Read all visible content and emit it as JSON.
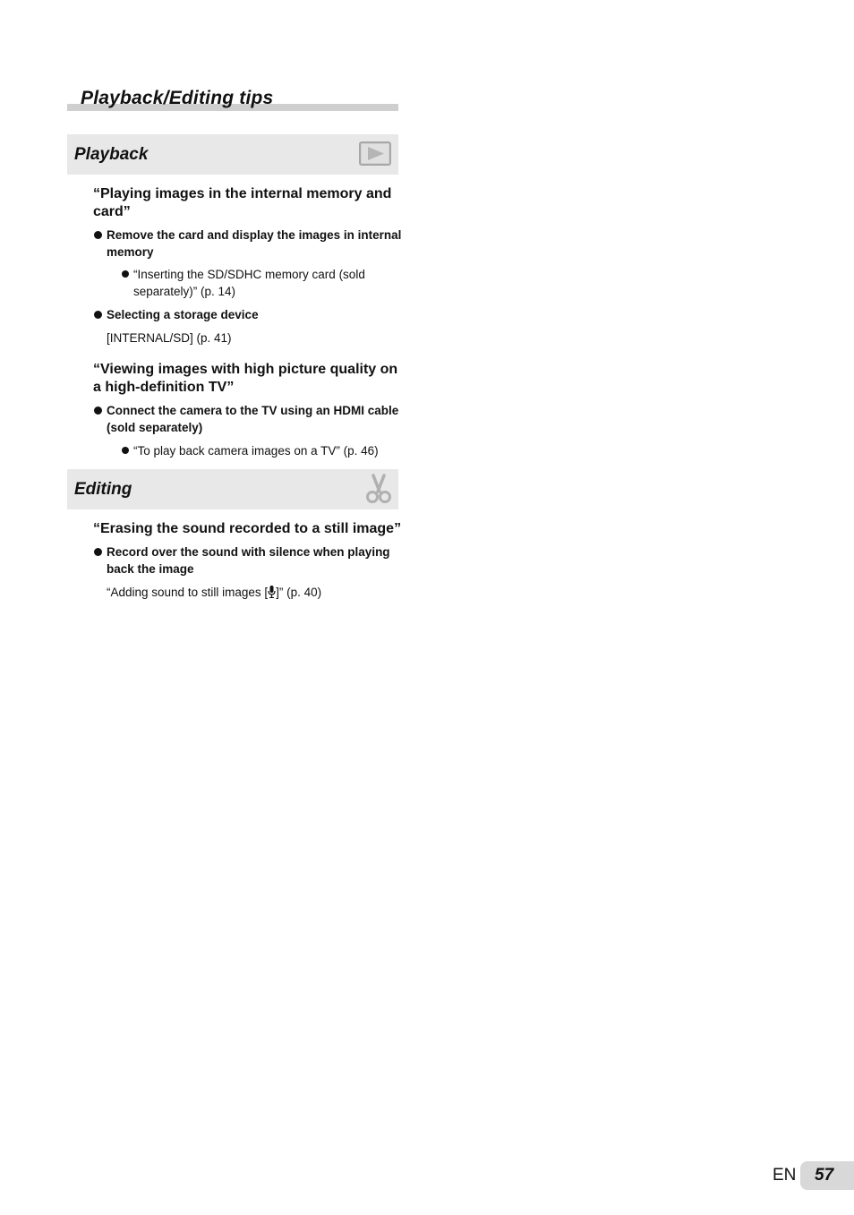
{
  "page_title": "Playback/Editing tips",
  "sections": [
    {
      "heading": "Playback",
      "icon": "playback-icon",
      "topics": [
        {
          "question": "“Playing images in the internal memory and card”",
          "items": [
            {
              "text": "Remove the card and display the images in internal memory",
              "sub": [
                "“Inserting the SD/SDHC memory card (sold separately)” (p. 14)"
              ]
            },
            {
              "text": "Selecting a storage device",
              "note": "[INTERNAL/SD] (p. 41)"
            }
          ]
        },
        {
          "question": "“Viewing images with high picture quality on a high-definition TV”",
          "items": [
            {
              "text": "Connect the camera to the TV using an HDMI cable (sold separately)",
              "sub": [
                "“To play back camera images on a TV” (p. 46)"
              ]
            }
          ]
        }
      ]
    },
    {
      "heading": "Editing",
      "icon": "scissors-icon",
      "topics": [
        {
          "question": "“Erasing the sound recorded to a still image”",
          "items": [
            {
              "text": "Record over the sound with silence when playing back the image",
              "note_before": "“Adding sound to still images [",
              "note_icon": "microphone-icon",
              "note_after": "]” (p. 40)"
            }
          ]
        }
      ]
    }
  ],
  "footer": {
    "language": "EN",
    "page_number": "57"
  }
}
